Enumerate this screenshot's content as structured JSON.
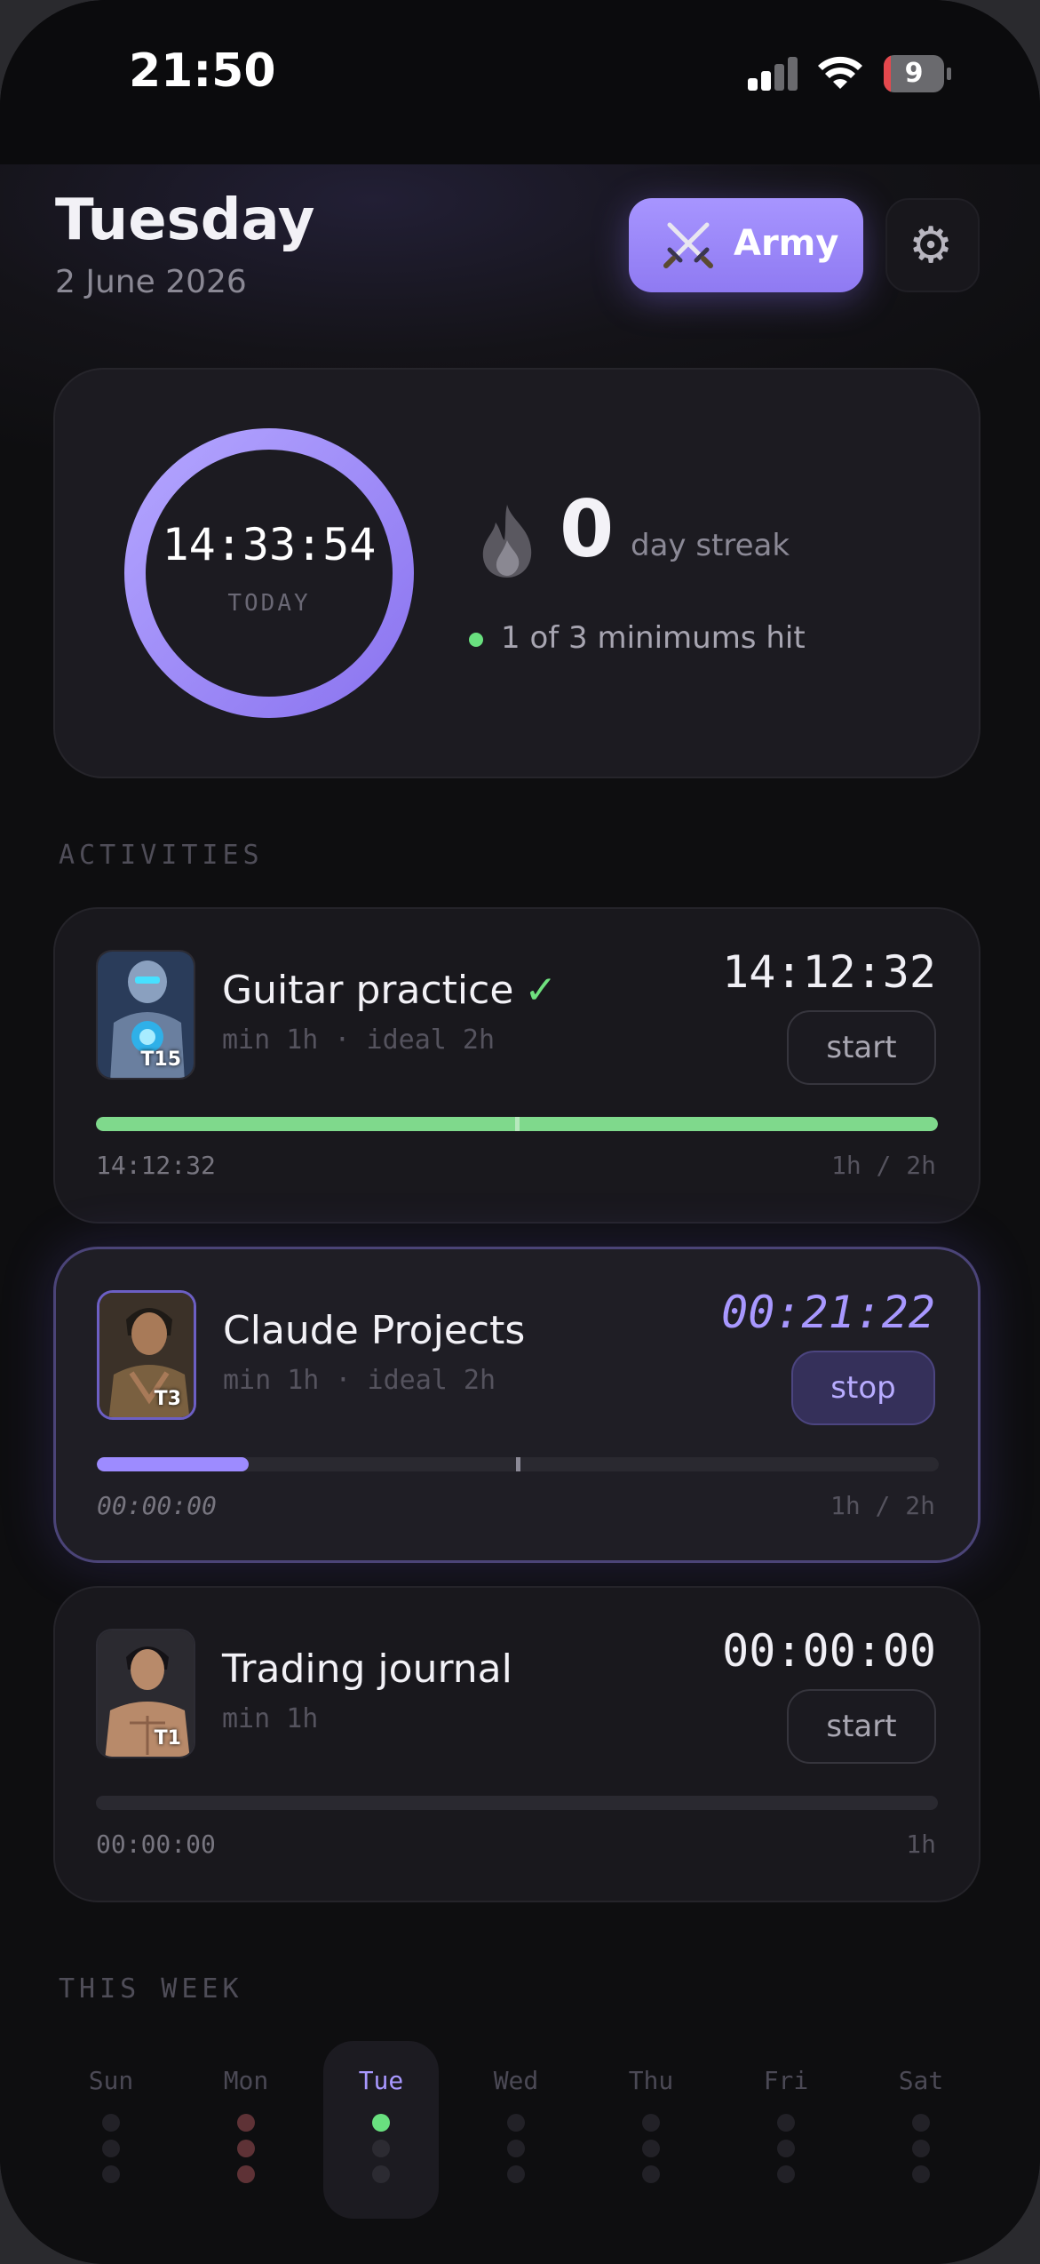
{
  "status_bar": {
    "time": "21:50",
    "battery": "9"
  },
  "header": {
    "day": "Tuesday",
    "date": "2 June 2026",
    "army_label": "Army"
  },
  "summary": {
    "ring_time": "14:33:54",
    "ring_label": "TODAY",
    "streak_count": "0",
    "streak_label": "day streak",
    "minimums_text": "1 of 3 minimums hit"
  },
  "sections": {
    "activities": "ACTIVITIES",
    "this_week": "THIS WEEK"
  },
  "activities": [
    {
      "name": "Guitar practice",
      "done": true,
      "meta": "min 1h · ideal 2h",
      "timer": "14:12:32",
      "button": "start",
      "tier": "T15",
      "bar_elapsed": "14:12:32",
      "bar_target": "1h / 2h",
      "progress": 1.0,
      "bar_color": "#7fd98c"
    },
    {
      "name": "Claude Projects",
      "done": false,
      "meta": "min 1h · ideal 2h",
      "timer": "00:21:22",
      "button": "stop",
      "tier": "T3",
      "bar_elapsed": "00:00:00",
      "bar_target": "1h / 2h",
      "progress": 0.18,
      "bar_color": "#9d8bff",
      "active": true
    },
    {
      "name": "Trading journal",
      "done": false,
      "meta": "min 1h",
      "timer": "00:00:00",
      "button": "start",
      "tier": "T1",
      "bar_elapsed": "00:00:00",
      "bar_target": "1h",
      "progress": 0.0,
      "bar_color": "#9d8bff"
    }
  ],
  "week": {
    "days": [
      "Sun",
      "Mon",
      "Tue",
      "Wed",
      "Thu",
      "Fri",
      "Sat"
    ],
    "today_index": 2,
    "dots": [
      [
        "none",
        "none",
        "none"
      ],
      [
        "red",
        "red",
        "red"
      ],
      [
        "green",
        "none",
        "none"
      ],
      [
        "none",
        "none",
        "none"
      ],
      [
        "none",
        "none",
        "none"
      ],
      [
        "none",
        "none",
        "none"
      ],
      [
        "none",
        "none",
        "none"
      ]
    ]
  },
  "colors": {
    "accent": "#9d8bff",
    "success": "#69e07f",
    "miss": "#5e3236",
    "empty": "#222127",
    "today_empty": "#2c2b32"
  }
}
